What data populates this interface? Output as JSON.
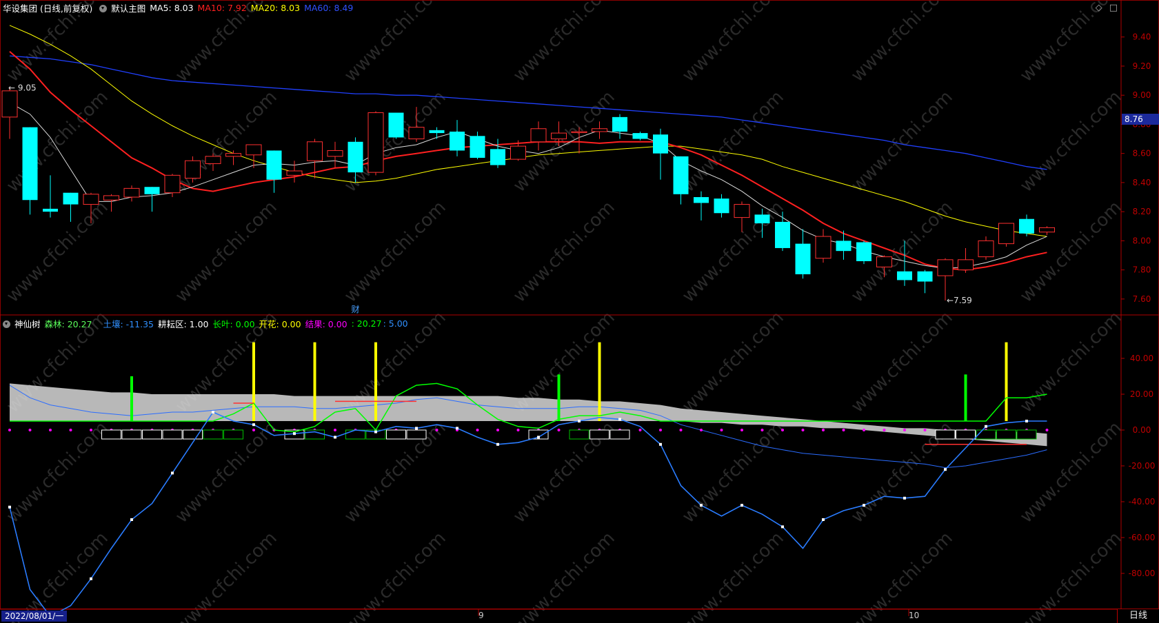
{
  "main_legend": {
    "stock": "华设集团 (日线,前复权)",
    "template": "默认主图",
    "ma5": {
      "label": "MA5: 8.03",
      "color": "#ffffff"
    },
    "ma10": {
      "label": "MA10: 7.92",
      "color": "#ff2020"
    },
    "ma20": {
      "label": "MA20: 8.03",
      "color": "#ffff00"
    },
    "ma60": {
      "label": "MA60: 8.49",
      "color": "#2040ff"
    }
  },
  "sub_legend": {
    "name": "神仙树",
    "forest": {
      "label": "森林: 20.27",
      "color": "#ff3030"
    },
    "soil": {
      "label": "土壤: -11.35",
      "color": "#3090ff"
    },
    "plow": {
      "label": "耕耘区: 1.00",
      "color": "#ffffff"
    },
    "leaf": {
      "label": "长叶: 0.00",
      "color": "#00ff00"
    },
    "bloom": {
      "label": "开花: 0.00",
      "color": "#ffff00"
    },
    "fruit": {
      "label": "结果: 0.00",
      "color": "#ff00ff"
    },
    "v1": {
      "label": ": 20.27",
      "color": "#00ff00"
    },
    "v2": {
      "label": ": 5.00",
      "color": "#3090ff"
    }
  },
  "current_price": "8.76",
  "annotations": {
    "high": "9.05",
    "low": "7.59",
    "finance_marker": "财"
  },
  "bottom": {
    "start_date": "2022/08/01/一",
    "months": [
      "9",
      "10"
    ],
    "period": "日线"
  },
  "watermark": "www.cfchi.com",
  "chart_data": [
    {
      "type": "candlestick",
      "title": "华设集团 (日线,前复权)",
      "ylim": [
        7.5,
        9.55
      ],
      "y_ticks": [
        7.6,
        7.8,
        8.0,
        8.2,
        8.4,
        8.6,
        8.8,
        9.0,
        9.2,
        9.4
      ],
      "y_tick_labels": [
        "7.60",
        "7.80",
        "8.00",
        "8.20",
        "8.40",
        "8.60",
        "8.80",
        "9.00",
        "9.20",
        "9.40"
      ],
      "candles": [
        {
          "o": 8.85,
          "h": 9.05,
          "l": 8.7,
          "c": 9.03
        },
        {
          "o": 8.78,
          "h": 8.78,
          "l": 8.18,
          "c": 8.28
        },
        {
          "o": 8.22,
          "h": 8.45,
          "l": 8.16,
          "c": 8.2
        },
        {
          "o": 8.33,
          "h": 8.33,
          "l": 8.13,
          "c": 8.25
        },
        {
          "o": 8.25,
          "h": 8.33,
          "l": 8.12,
          "c": 8.32
        },
        {
          "o": 8.28,
          "h": 8.32,
          "l": 8.2,
          "c": 8.31
        },
        {
          "o": 8.3,
          "h": 8.38,
          "l": 8.27,
          "c": 8.36
        },
        {
          "o": 8.37,
          "h": 8.37,
          "l": 8.2,
          "c": 8.32
        },
        {
          "o": 8.33,
          "h": 8.46,
          "l": 8.3,
          "c": 8.45
        },
        {
          "o": 8.43,
          "h": 8.58,
          "l": 8.4,
          "c": 8.55
        },
        {
          "o": 8.53,
          "h": 8.6,
          "l": 8.48,
          "c": 8.58
        },
        {
          "o": 8.58,
          "h": 8.62,
          "l": 8.52,
          "c": 8.6
        },
        {
          "o": 8.59,
          "h": 8.64,
          "l": 8.5,
          "c": 8.66
        },
        {
          "o": 8.62,
          "h": 8.62,
          "l": 8.33,
          "c": 8.42
        },
        {
          "o": 8.45,
          "h": 8.55,
          "l": 8.4,
          "c": 8.48
        },
        {
          "o": 8.55,
          "h": 8.7,
          "l": 8.43,
          "c": 8.68
        },
        {
          "o": 8.58,
          "h": 8.68,
          "l": 8.5,
          "c": 8.62
        },
        {
          "o": 8.68,
          "h": 8.71,
          "l": 8.4,
          "c": 8.47
        },
        {
          "o": 8.47,
          "h": 8.89,
          "l": 8.45,
          "c": 8.88
        },
        {
          "o": 8.88,
          "h": 8.88,
          "l": 8.7,
          "c": 8.71
        },
        {
          "o": 8.7,
          "h": 8.92,
          "l": 8.68,
          "c": 8.78
        },
        {
          "o": 8.76,
          "h": 8.78,
          "l": 8.7,
          "c": 8.74
        },
        {
          "o": 8.75,
          "h": 8.83,
          "l": 8.58,
          "c": 8.62
        },
        {
          "o": 8.72,
          "h": 8.75,
          "l": 8.56,
          "c": 8.57
        },
        {
          "o": 8.63,
          "h": 8.7,
          "l": 8.5,
          "c": 8.52
        },
        {
          "o": 8.56,
          "h": 8.69,
          "l": 8.55,
          "c": 8.65
        },
        {
          "o": 8.68,
          "h": 8.82,
          "l": 8.62,
          "c": 8.77
        },
        {
          "o": 8.7,
          "h": 8.82,
          "l": 8.65,
          "c": 8.74
        },
        {
          "o": 8.75,
          "h": 8.78,
          "l": 8.6,
          "c": 8.75
        },
        {
          "o": 8.75,
          "h": 8.82,
          "l": 8.7,
          "c": 8.77
        },
        {
          "o": 8.85,
          "h": 8.87,
          "l": 8.7,
          "c": 8.75
        },
        {
          "o": 8.74,
          "h": 8.75,
          "l": 8.69,
          "c": 8.7
        },
        {
          "o": 8.73,
          "h": 8.77,
          "l": 8.42,
          "c": 8.6
        },
        {
          "o": 8.58,
          "h": 8.58,
          "l": 8.25,
          "c": 8.32
        },
        {
          "o": 8.3,
          "h": 8.34,
          "l": 8.14,
          "c": 8.26
        },
        {
          "o": 8.29,
          "h": 8.32,
          "l": 8.16,
          "c": 8.19
        },
        {
          "o": 8.16,
          "h": 8.27,
          "l": 8.06,
          "c": 8.25
        },
        {
          "o": 8.18,
          "h": 8.22,
          "l": 8.02,
          "c": 8.12
        },
        {
          "o": 8.13,
          "h": 8.2,
          "l": 7.93,
          "c": 7.95
        },
        {
          "o": 7.98,
          "h": 8.08,
          "l": 7.74,
          "c": 7.77
        },
        {
          "o": 7.88,
          "h": 8.08,
          "l": 7.85,
          "c": 8.03
        },
        {
          "o": 8.0,
          "h": 8.07,
          "l": 7.87,
          "c": 7.93
        },
        {
          "o": 7.99,
          "h": 8.0,
          "l": 7.84,
          "c": 7.86
        },
        {
          "o": 7.82,
          "h": 7.9,
          "l": 7.75,
          "c": 7.89
        },
        {
          "o": 7.79,
          "h": 8.0,
          "l": 7.69,
          "c": 7.73
        },
        {
          "o": 7.79,
          "h": 7.8,
          "l": 7.64,
          "c": 7.72
        },
        {
          "o": 7.76,
          "h": 7.88,
          "l": 7.59,
          "c": 7.87
        },
        {
          "o": 7.8,
          "h": 7.95,
          "l": 7.78,
          "c": 7.87
        },
        {
          "o": 7.89,
          "h": 8.03,
          "l": 7.87,
          "c": 8.0
        },
        {
          "o": 7.98,
          "h": 8.12,
          "l": 7.96,
          "c": 8.12
        },
        {
          "o": 8.15,
          "h": 8.18,
          "l": 8.03,
          "c": 8.05
        },
        {
          "o": 8.06,
          "h": 8.1,
          "l": 8.04,
          "c": 8.09
        }
      ],
      "ma5": [
        8.95,
        8.87,
        8.71,
        8.49,
        8.27,
        8.27,
        8.3,
        8.31,
        8.33,
        8.37,
        8.42,
        8.47,
        8.52,
        8.53,
        8.52,
        8.54,
        8.55,
        8.52,
        8.6,
        8.64,
        8.66,
        8.71,
        8.75,
        8.7,
        8.65,
        8.62,
        8.6,
        8.64,
        8.71,
        8.76,
        8.74,
        8.72,
        8.67,
        8.55,
        8.48,
        8.42,
        8.34,
        8.24,
        8.16,
        8.07,
        8.01,
        7.98,
        7.93,
        7.89,
        7.86,
        7.83,
        7.81,
        7.82,
        7.85,
        7.89,
        7.97,
        8.03
      ],
      "ma10": [
        9.3,
        9.18,
        9.02,
        8.9,
        8.79,
        8.68,
        8.57,
        8.5,
        8.42,
        8.36,
        8.34,
        8.37,
        8.4,
        8.42,
        8.44,
        8.47,
        8.5,
        8.51,
        8.55,
        8.58,
        8.6,
        8.62,
        8.64,
        8.65,
        8.66,
        8.67,
        8.68,
        8.68,
        8.68,
        8.67,
        8.68,
        8.68,
        8.68,
        8.64,
        8.59,
        8.52,
        8.45,
        8.37,
        8.29,
        8.21,
        8.12,
        8.05,
        8.0,
        7.95,
        7.9,
        7.84,
        7.81,
        7.8,
        7.82,
        7.85,
        7.89,
        7.92
      ],
      "ma20": [
        9.48,
        9.42,
        9.35,
        9.27,
        9.18,
        9.07,
        8.96,
        8.87,
        8.79,
        8.72,
        8.66,
        8.6,
        8.55,
        8.51,
        8.47,
        8.44,
        8.42,
        8.4,
        8.41,
        8.43,
        8.46,
        8.49,
        8.51,
        8.53,
        8.55,
        8.57,
        8.59,
        8.6,
        8.61,
        8.62,
        8.63,
        8.64,
        8.65,
        8.65,
        8.63,
        8.61,
        8.59,
        8.56,
        8.51,
        8.47,
        8.43,
        8.39,
        8.35,
        8.31,
        8.27,
        8.22,
        8.17,
        8.13,
        8.1,
        8.07,
        8.05,
        8.03
      ],
      "ma60": [
        9.27,
        9.26,
        9.25,
        9.23,
        9.21,
        9.18,
        9.15,
        9.12,
        9.1,
        9.09,
        9.08,
        9.07,
        9.06,
        9.05,
        9.04,
        9.03,
        9.02,
        9.01,
        9.01,
        9.0,
        9.0,
        8.99,
        8.98,
        8.97,
        8.96,
        8.95,
        8.94,
        8.93,
        8.92,
        8.91,
        8.9,
        8.89,
        8.88,
        8.87,
        8.86,
        8.85,
        8.83,
        8.81,
        8.79,
        8.77,
        8.75,
        8.73,
        8.71,
        8.69,
        8.66,
        8.64,
        8.62,
        8.6,
        8.57,
        8.54,
        8.51,
        8.49
      ]
    },
    {
      "type": "line",
      "title": "神仙树",
      "ylim": [
        -100,
        55
      ],
      "y_ticks": [
        -80,
        -60,
        -40,
        -20,
        0,
        20,
        40
      ],
      "y_tick_labels": [
        "-80.00",
        "-60.00",
        "-40.00",
        "-20.00",
        "0.00",
        "20.00",
        "40.00"
      ],
      "soil_line": [
        -43,
        -89,
        -104,
        -98,
        -83,
        -66,
        -50,
        -41,
        -24,
        -7,
        10,
        5,
        3,
        -3,
        -2,
        -1,
        -4,
        0,
        -1,
        2,
        1,
        3,
        1,
        -4,
        -8,
        -7,
        -4,
        3,
        5,
        7,
        6,
        2,
        -8,
        -31,
        -42,
        -48,
        -42,
        -47,
        -54,
        -66,
        -50,
        -45,
        -42,
        -37,
        -38,
        -37,
        -22,
        -10,
        2,
        4,
        5,
        5
      ],
      "trend_line": [
        25,
        18,
        14,
        12,
        10,
        9,
        8,
        9,
        10,
        10,
        11,
        12,
        13,
        13,
        13,
        12,
        12,
        13,
        14,
        15,
        17,
        18,
        16,
        14,
        13,
        12,
        12,
        12,
        13,
        13,
        12,
        11,
        8,
        3,
        0,
        -3,
        -6,
        -9,
        -11,
        -13,
        -14,
        -15,
        -16,
        -17,
        -18,
        -19,
        -21,
        -20,
        -18,
        -16,
        -14,
        -11
      ],
      "green_line": [
        5,
        5,
        5,
        5,
        5,
        5,
        5,
        5,
        5,
        5,
        5,
        9,
        15,
        0,
        -1,
        2,
        10,
        12,
        0,
        19,
        25,
        26,
        23,
        14,
        6,
        2,
        1,
        6,
        8,
        8,
        10,
        8,
        5,
        5,
        5,
        5,
        5,
        5,
        5,
        5,
        5,
        5,
        5,
        5,
        5,
        5,
        5,
        5,
        5,
        18,
        18,
        20
      ],
      "green_bars": [
        {
          "i": 6,
          "v": 30
        },
        {
          "i": 27,
          "v": 31
        },
        {
          "i": 47,
          "v": 31
        }
      ],
      "yellow_bars": [
        {
          "i": 12,
          "v": 49
        },
        {
          "i": 15,
          "v": 49
        },
        {
          "i": 18,
          "v": 49
        },
        {
          "i": 29,
          "v": 49
        },
        {
          "i": 49,
          "v": 49
        }
      ],
      "blocks": [
        {
          "i": 5,
          "c": "w"
        },
        {
          "i": 6,
          "c": "w"
        },
        {
          "i": 7,
          "c": "w"
        },
        {
          "i": 8,
          "c": "w"
        },
        {
          "i": 9,
          "c": "w"
        },
        {
          "i": 10,
          "c": "g"
        },
        {
          "i": 11,
          "c": "g"
        },
        {
          "i": 14,
          "c": "w"
        },
        {
          "i": 15,
          "c": "g"
        },
        {
          "i": 17,
          "c": "g"
        },
        {
          "i": 18,
          "c": "g"
        },
        {
          "i": 19,
          "c": "w"
        },
        {
          "i": 20,
          "c": "w"
        },
        {
          "i": 26,
          "c": "w"
        },
        {
          "i": 28,
          "c": "g"
        },
        {
          "i": 29,
          "c": "w"
        },
        {
          "i": 30,
          "c": "w"
        },
        {
          "i": 46,
          "c": "w"
        },
        {
          "i": 47,
          "c": "w"
        },
        {
          "i": 48,
          "c": "g"
        },
        {
          "i": 49,
          "c": "g"
        },
        {
          "i": 50,
          "c": "g"
        }
      ],
      "band_top": [
        26,
        25,
        24,
        23,
        22,
        21,
        21,
        20,
        20,
        20,
        20,
        20,
        20,
        20,
        19,
        19,
        19,
        19,
        19,
        19,
        19,
        19,
        19,
        19,
        19,
        18,
        18,
        17,
        17,
        16,
        16,
        15,
        14,
        12,
        11,
        10,
        9,
        8,
        7,
        6,
        5,
        4,
        3,
        2,
        1,
        1,
        0,
        0,
        -1,
        -1,
        -1,
        -2
      ],
      "band_bottom": [
        5,
        5,
        5,
        5,
        5,
        5,
        5,
        5,
        5,
        5,
        5,
        5,
        5,
        5,
        5,
        5,
        5,
        5,
        5,
        5,
        5,
        5,
        5,
        5,
        5,
        5,
        5,
        5,
        5,
        5,
        5,
        5,
        5,
        5,
        4,
        4,
        3,
        3,
        2,
        2,
        1,
        1,
        0,
        -1,
        -2,
        -3,
        -4,
        -5,
        -6,
        -7,
        -8,
        -9
      ]
    }
  ]
}
